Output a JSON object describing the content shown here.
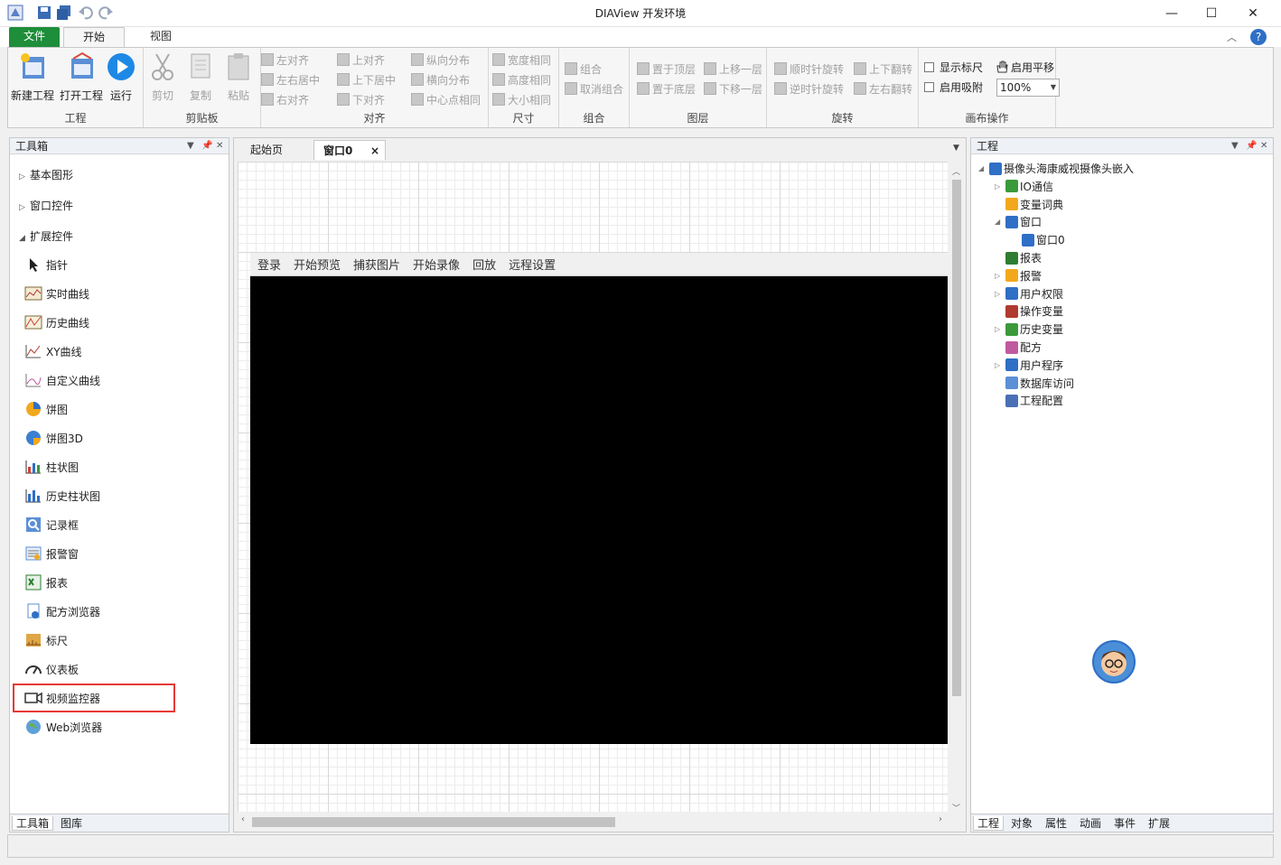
{
  "window": {
    "title": "DIAView 开发环境",
    "controls": [
      "—",
      "☐",
      "✕"
    ]
  },
  "ribbon_tabs": {
    "file": "文件",
    "home": "开始",
    "view": "视图"
  },
  "ribbon": {
    "project": {
      "title": "工程",
      "new": "新建工程",
      "open": "打开工程",
      "run": "运行"
    },
    "clipboard": {
      "title": "剪贴板",
      "cut": "剪切",
      "copy": "复制",
      "paste": "粘贴"
    },
    "align": {
      "title": "对齐",
      "left": "左对齐",
      "hcenter": "左右居中",
      "right": "右对齐",
      "top": "上对齐",
      "vcenter": "上下居中",
      "bottom": "下对齐",
      "vdist": "纵向分布",
      "hdist": "横向分布",
      "centersame": "中心点相同"
    },
    "size": {
      "title": "尺寸",
      "width": "宽度相同",
      "height": "高度相同",
      "size": "大小相同"
    },
    "combine": {
      "title": "组合",
      "group": "组合",
      "ungroup": "取消组合"
    },
    "layer": {
      "title": "图层",
      "top": "置于顶层",
      "bottom": "置于底层",
      "up": "上移一层",
      "down": "下移一层"
    },
    "rotate": {
      "title": "旋转",
      "cw": "顺时针旋转",
      "ccw": "逆时针旋转",
      "vflip": "上下翻转",
      "hflip": "左右翻转"
    },
    "canvas": {
      "title": "画布操作",
      "ruler": "显示标尺",
      "pan": "启用平移",
      "snap": "启用吸附",
      "zoom": "100%"
    }
  },
  "toolbox": {
    "title": "工具箱",
    "categories": [
      "基本图形",
      "窗口控件",
      "扩展控件"
    ],
    "items": [
      "指针",
      "实时曲线",
      "历史曲线",
      "XY曲线",
      "自定义曲线",
      "饼图",
      "饼图3D",
      "柱状图",
      "历史柱状图",
      "记录框",
      "报警窗",
      "报表",
      "配方浏览器",
      "标尺",
      "仪表板",
      "视频监控器",
      "Web浏览器"
    ],
    "bottom_tabs": [
      "工具箱",
      "图库"
    ]
  },
  "documents": {
    "tabs": [
      "起始页",
      "窗口0"
    ],
    "close_glyph": "×",
    "video_menu": [
      "登录",
      "开始预览",
      "捕获图片",
      "开始录像",
      "回放",
      "远程设置"
    ]
  },
  "project": {
    "title": "工程",
    "tree": [
      {
        "label": "摄像头海康威视摄像头嵌入",
        "level": 0,
        "exp": "◢"
      },
      {
        "label": "IO通信",
        "level": 1,
        "exp": "▷"
      },
      {
        "label": "变量词典",
        "level": 1,
        "exp": ""
      },
      {
        "label": "窗口",
        "level": 1,
        "exp": "◢"
      },
      {
        "label": "窗口0",
        "level": 2,
        "exp": ""
      },
      {
        "label": "报表",
        "level": 1,
        "exp": ""
      },
      {
        "label": "报警",
        "level": 1,
        "exp": "▷"
      },
      {
        "label": "用户权限",
        "level": 1,
        "exp": "▷"
      },
      {
        "label": "操作变量",
        "level": 1,
        "exp": ""
      },
      {
        "label": "历史变量",
        "level": 1,
        "exp": "▷"
      },
      {
        "label": "配方",
        "level": 1,
        "exp": ""
      },
      {
        "label": "用户程序",
        "level": 1,
        "exp": "▷"
      },
      {
        "label": "数据库访问",
        "level": 1,
        "exp": ""
      },
      {
        "label": "工程配置",
        "level": 1,
        "exp": ""
      }
    ],
    "bottom_tabs": [
      "工程",
      "对象",
      "属性",
      "动画",
      "事件",
      "扩展"
    ]
  }
}
